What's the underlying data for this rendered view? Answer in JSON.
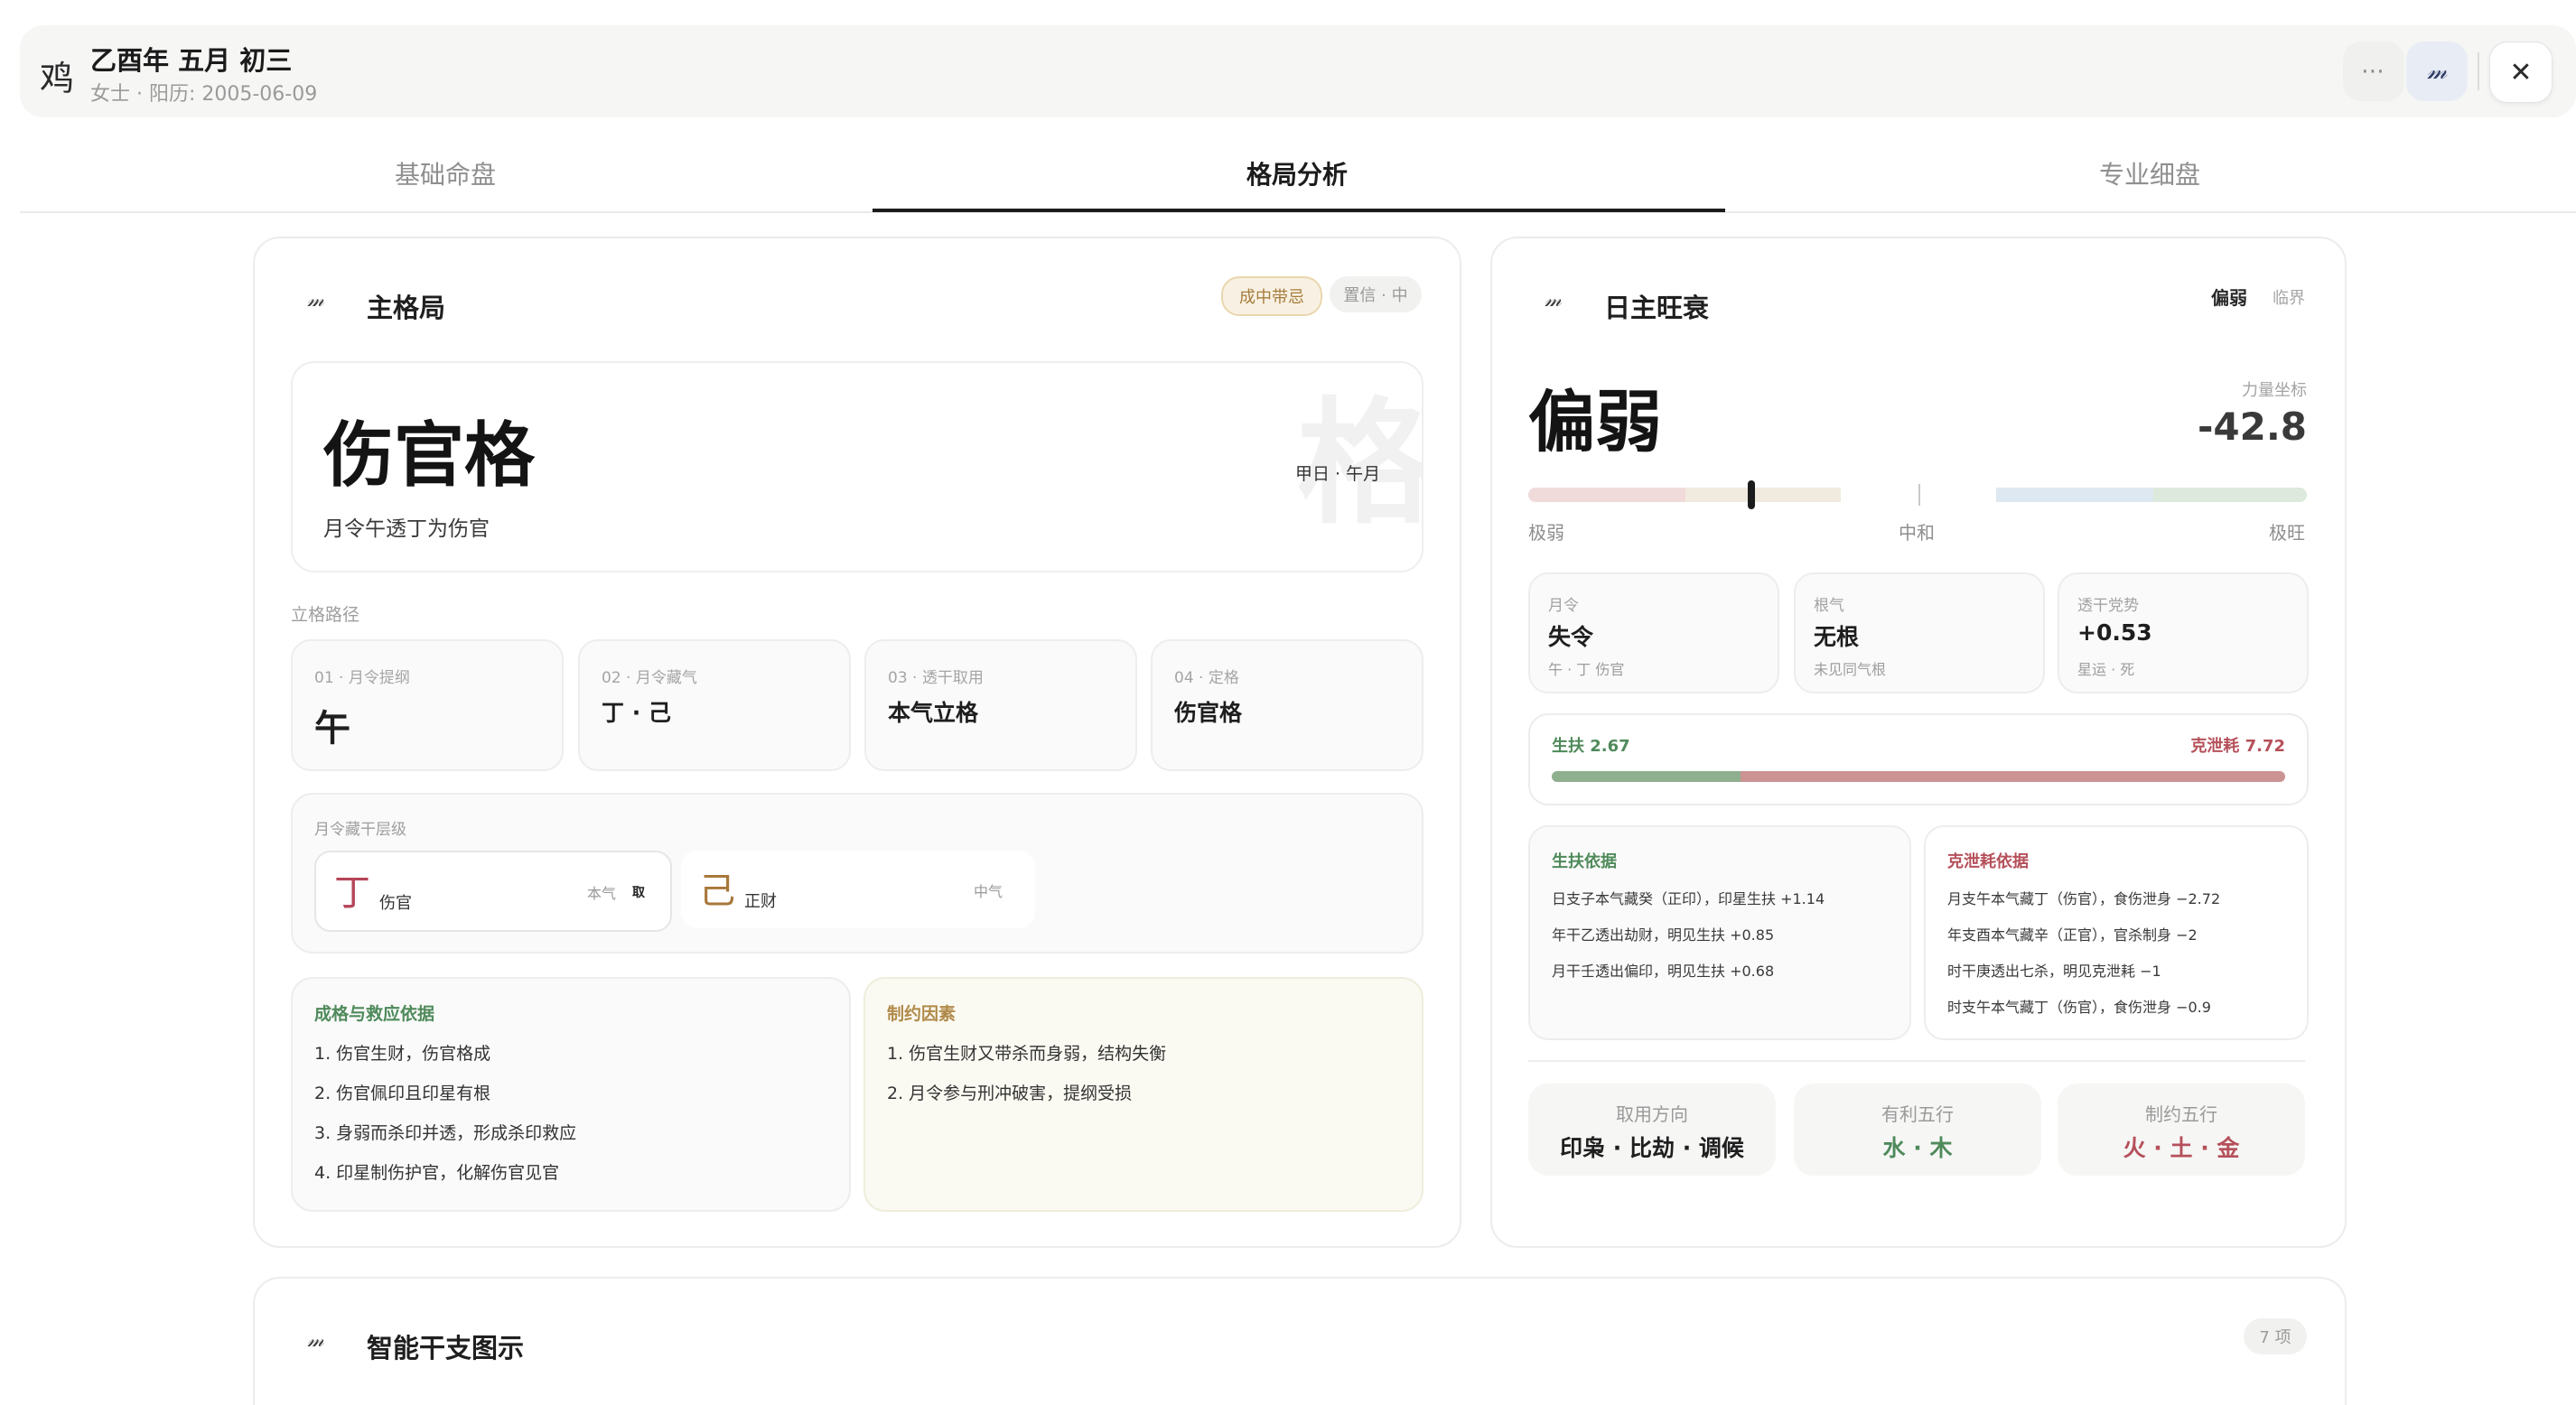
{
  "header": {
    "zodiac": "鸡",
    "title": "乙酉年 五月 初三",
    "subtitle": "女士 · 阳历: 2005-06-09",
    "more_icon": "⋯",
    "logo_glyph": "𝓂",
    "close_icon": "✕"
  },
  "tabs": [
    {
      "label": "基础命盘",
      "active": false
    },
    {
      "label": "格局分析",
      "active": true
    },
    {
      "label": "专业细盘",
      "active": false
    }
  ],
  "pattern_card": {
    "title": "主格局",
    "badge_status": "成中带忌",
    "badge_confidence": "置信 · 中",
    "hero": {
      "name": "伤官格",
      "watermark": "格",
      "side_note": "甲日 · 午月",
      "description": "月令午透丁为伤官"
    },
    "path_label": "立格路径",
    "steps": [
      {
        "label": "01 · 月令提纲",
        "value": "午"
      },
      {
        "label": "02 · 月令藏气",
        "value": "丁 · 己"
      },
      {
        "label": "03 · 透干取用",
        "value": "本气立格"
      },
      {
        "label": "04 · 定格",
        "value": "伤官格"
      }
    ],
    "hidden_stems": {
      "label": "月令藏干层级",
      "items": [
        {
          "stem": "丁",
          "god": "伤官",
          "level": "本气",
          "tag": "取",
          "stem_color": "#b5455a"
        },
        {
          "stem": "己",
          "god": "正财",
          "level": "中气",
          "tag": "",
          "stem_color": "#a8773a"
        }
      ]
    },
    "basis": {
      "title": "成格与救应依据",
      "items": [
        "1. 伤官生财，伤官格成",
        "2. 伤官佩印且印星有根",
        "3. 身弱而杀印并透，形成杀印救应",
        "4. 印星制伤护官，化解伤官见官"
      ]
    },
    "restraint": {
      "title": "制约因素",
      "items": [
        "1. 伤官生财又带杀而身弱，结构失衡",
        "2. 月令参与刑冲破害，提纲受损"
      ]
    }
  },
  "strength_card": {
    "title": "日主旺衰",
    "tag_primary": "偏弱",
    "tag_secondary": "临界",
    "verdict": "偏弱",
    "coord_label": "力量坐标",
    "coord_value": "-42.8",
    "scale": {
      "left": "极弱",
      "center": "中和",
      "right": "极旺",
      "marker_fraction": 0.286
    },
    "meta": [
      {
        "label": "月令",
        "value": "失令",
        "sub": "午 · 丁 伤官"
      },
      {
        "label": "根气",
        "value": "无根",
        "sub": "未见同气根"
      },
      {
        "label": "透干党势",
        "value": "+0.53",
        "sub": "星运 · 死"
      }
    ],
    "balance": {
      "support_label": "生扶 2.67",
      "drain_label": "克泄耗 7.72",
      "support": 2.67,
      "drain": 7.72
    },
    "support_evidence": {
      "title": "生扶依据",
      "items": [
        "日支子本气藏癸（正印），印星生扶 +1.14",
        "年干乙透出劫财，明见生扶 +0.85",
        "月干壬透出偏印，明见生扶 +0.68"
      ]
    },
    "drain_evidence": {
      "title": "克泄耗依据",
      "items": [
        "月支午本气藏丁（伤官），食伤泄身 −2.72",
        "年支酉本气藏辛（正官），官杀制身 −2",
        "时干庚透出七杀，明见克泄耗 −1",
        "时支午本气藏丁（伤官），食伤泄身 −0.9"
      ]
    },
    "directions": [
      {
        "label": "取用方向",
        "value": "印枭 · 比劫 · 调候",
        "color": "#1f1f1f"
      },
      {
        "label": "有利五行",
        "value": "水 · 木",
        "color": "#4f8a5b"
      },
      {
        "label": "制约五行",
        "value": "火 · 土 · 金",
        "color": "#b5505a"
      }
    ]
  },
  "diagram_card": {
    "title": "智能干支图示",
    "count": "7 项"
  },
  "colors": {
    "accent_dark": "#1c1c1c",
    "support_green": "#8fb08f",
    "drain_red": "#cc9393",
    "badge_gold": "#b08a4a"
  }
}
